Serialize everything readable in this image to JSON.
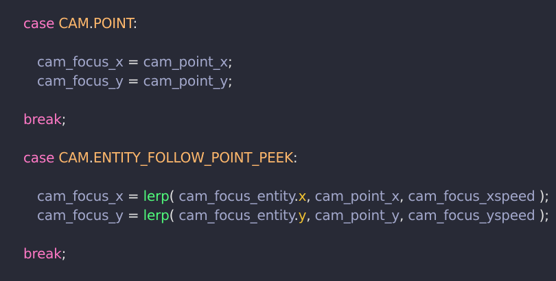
{
  "code": {
    "lines": [
      {
        "tokens": [
          {
            "t": "case",
            "c": "kw"
          },
          {
            "t": " ",
            "c": "punc"
          },
          {
            "t": "CAM",
            "c": "const"
          },
          {
            "t": ".",
            "c": "punc"
          },
          {
            "t": "POINT",
            "c": "const"
          },
          {
            "t": ":",
            "c": "punc"
          }
        ]
      },
      {
        "tokens": [
          {
            "t": "cam_focus_x",
            "c": "var"
          },
          {
            "t": " = ",
            "c": "punc"
          },
          {
            "t": "cam_point_x",
            "c": "var"
          },
          {
            "t": ";",
            "c": "punc"
          }
        ]
      },
      {
        "tokens": [
          {
            "t": "cam_focus_y",
            "c": "var"
          },
          {
            "t": " = ",
            "c": "punc"
          },
          {
            "t": "cam_point_y",
            "c": "var"
          },
          {
            "t": ";",
            "c": "punc"
          }
        ]
      },
      {
        "tokens": [
          {
            "t": "break",
            "c": "kw"
          },
          {
            "t": ";",
            "c": "punc"
          }
        ]
      },
      {
        "tokens": [
          {
            "t": "case",
            "c": "kw"
          },
          {
            "t": " ",
            "c": "punc"
          },
          {
            "t": "CAM",
            "c": "const"
          },
          {
            "t": ".",
            "c": "punc"
          },
          {
            "t": "ENTITY_FOLLOW_POINT_PEEK",
            "c": "const"
          },
          {
            "t": ":",
            "c": "punc"
          }
        ]
      },
      {
        "tokens": [
          {
            "t": "cam_focus_x",
            "c": "var"
          },
          {
            "t": " = ",
            "c": "punc"
          },
          {
            "t": "lerp",
            "c": "fn"
          },
          {
            "t": "( ",
            "c": "punc"
          },
          {
            "t": "cam_focus_entity",
            "c": "var"
          },
          {
            "t": ".",
            "c": "punc"
          },
          {
            "t": "x",
            "c": "prop"
          },
          {
            "t": ", ",
            "c": "punc"
          },
          {
            "t": "cam_point_x",
            "c": "var"
          },
          {
            "t": ", ",
            "c": "punc"
          },
          {
            "t": "cam_focus_xspeed",
            "c": "var"
          },
          {
            "t": " );",
            "c": "punc"
          }
        ]
      },
      {
        "tokens": [
          {
            "t": "cam_focus_y",
            "c": "var"
          },
          {
            "t": " = ",
            "c": "punc"
          },
          {
            "t": "lerp",
            "c": "fn"
          },
          {
            "t": "( ",
            "c": "punc"
          },
          {
            "t": "cam_focus_entity",
            "c": "var"
          },
          {
            "t": ".",
            "c": "punc"
          },
          {
            "t": "y",
            "c": "prop"
          },
          {
            "t": ", ",
            "c": "punc"
          },
          {
            "t": "cam_point_y",
            "c": "var"
          },
          {
            "t": ", ",
            "c": "punc"
          },
          {
            "t": "cam_focus_yspeed",
            "c": "var"
          },
          {
            "t": " );",
            "c": "punc"
          }
        ]
      },
      {
        "tokens": [
          {
            "t": "break",
            "c": "kw"
          },
          {
            "t": ";",
            "c": "punc"
          }
        ]
      }
    ]
  },
  "colors": {
    "background": "#282a36",
    "keyword": "#ff79c6",
    "constant": "#ffb86c",
    "variable": "#a3a8cc",
    "function": "#50fa7b",
    "property": "#f1c232",
    "punctuation": "#e2e2e2"
  }
}
